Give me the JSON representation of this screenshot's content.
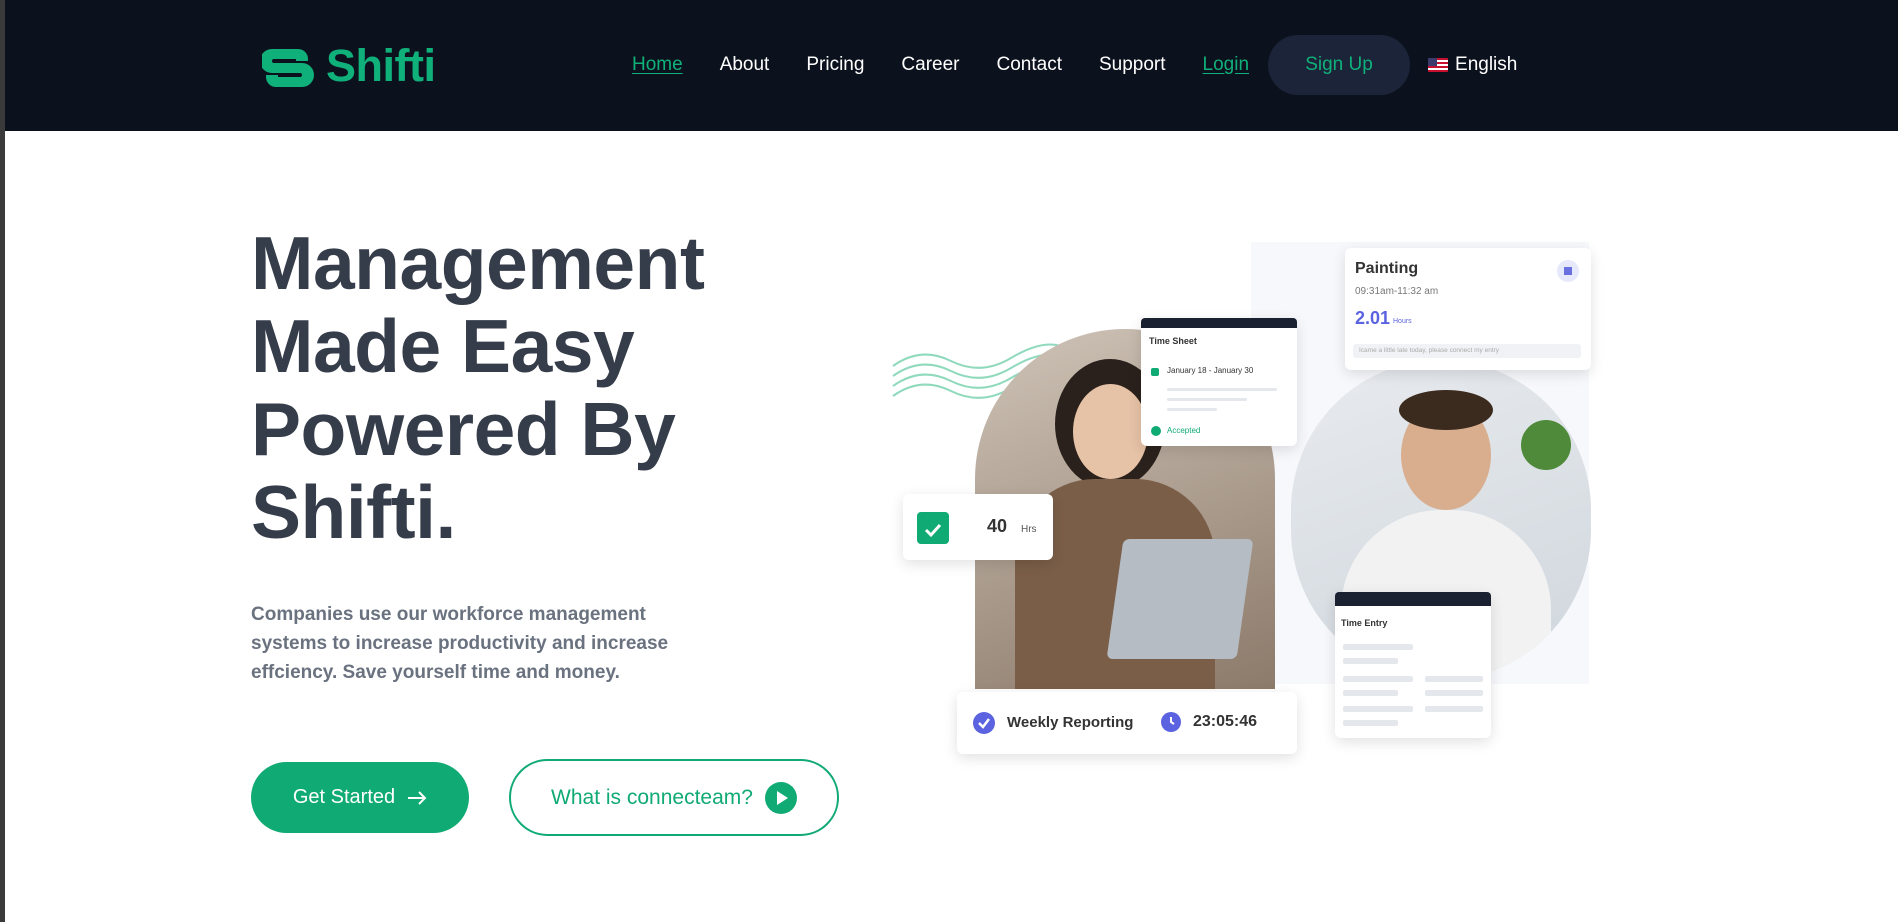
{
  "brand": {
    "name": "Shifti",
    "accent": "#10b07a",
    "header_bg": "#0c121d"
  },
  "nav": {
    "items": [
      {
        "label": "Home",
        "active": true
      },
      {
        "label": "About"
      },
      {
        "label": "Pricing"
      },
      {
        "label": "Career"
      },
      {
        "label": "Contact"
      },
      {
        "label": "Support"
      }
    ],
    "login": "Login",
    "signup": "Sign Up",
    "language": "English"
  },
  "hero": {
    "title_lines": [
      "Management",
      "Made Easy",
      "Powered By",
      "Shifti."
    ],
    "description": "Companies use our workforce management systems to increase productivity and increase effciency. Save yourself time and money.",
    "primary_button": "Get Started",
    "secondary_button": "What is connecteam?"
  },
  "illustration": {
    "painting_card": {
      "title": "Painting",
      "time": "09:31am-11:32 am",
      "hours": "2.01",
      "hours_unit": "Hours",
      "note": "Icame a little late today, please connect my entry"
    },
    "timesheet_card": {
      "title": "Time Sheet",
      "range": "January 18 - January 30",
      "status": "Accepted"
    },
    "hours_card": {
      "value": "40",
      "unit": "Hrs"
    },
    "time_entry_card": {
      "title": "Time Entry"
    },
    "reporting_bar": {
      "label": "Weekly Reporting",
      "timer": "23:05:46"
    }
  }
}
